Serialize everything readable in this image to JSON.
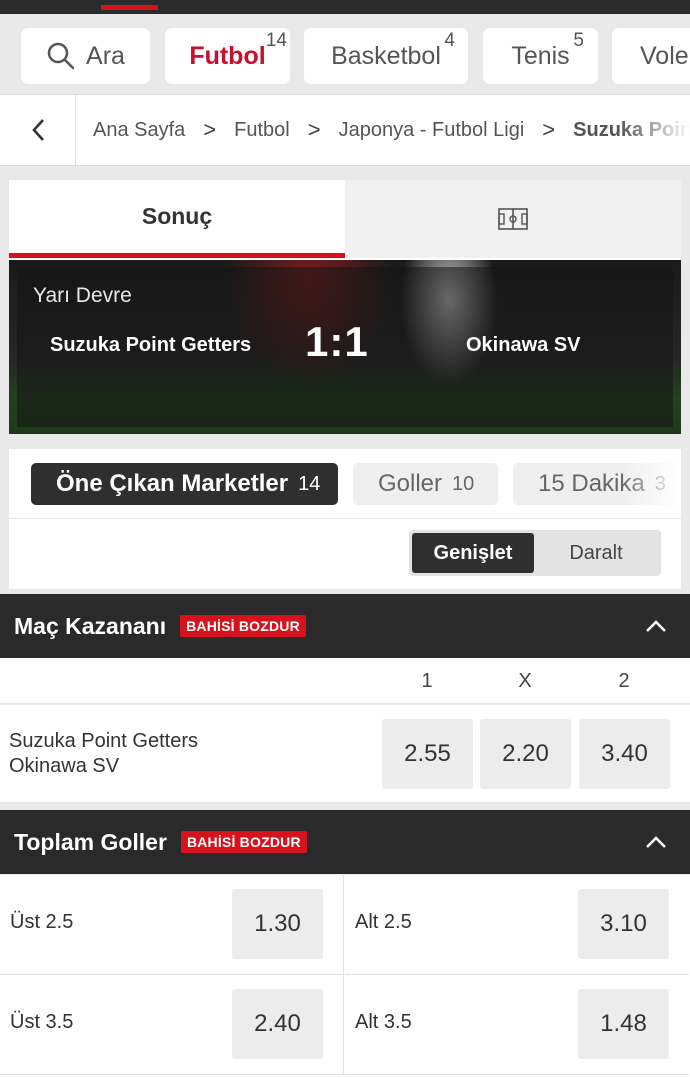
{
  "sports_tabs": [
    {
      "label": "Ara",
      "count": ""
    },
    {
      "label": "Futbol",
      "count": "14"
    },
    {
      "label": "Basketbol",
      "count": "4"
    },
    {
      "label": "Tenis",
      "count": "5"
    },
    {
      "label": "Vole",
      "count": ""
    }
  ],
  "breadcrumb": {
    "items": [
      "Ana Sayfa",
      "Futbol",
      "Japonya - Futbol Ligi"
    ],
    "current": "Suzuka Poin",
    "separator": ">"
  },
  "scorecard": {
    "tab_result": "Sonuç",
    "status": "Yarı Devre",
    "home": "Suzuka Point Getters",
    "score": "1:1",
    "away": "Okinawa SV"
  },
  "market_tabs": [
    {
      "label": "Öne Çıkan Marketler",
      "count": "14"
    },
    {
      "label": "Goller",
      "count": "10"
    },
    {
      "label": "15 Dakika",
      "count": "3"
    }
  ],
  "view_toggle": {
    "expand": "Genişlet",
    "collapse": "Daralt"
  },
  "match_winner": {
    "title": "Maç Kazananı",
    "badge": "BAHİSİ BOZDUR",
    "col_labels": [
      "1",
      "X",
      "2"
    ],
    "team1": "Suzuka Point Getters",
    "team2": "Okinawa SV",
    "odds": [
      "2.55",
      "2.20",
      "3.40"
    ]
  },
  "total_goals": {
    "title": "Toplam Goller",
    "badge": "BAHİSİ BOZDUR",
    "rows": [
      {
        "over_label": "Üst 2.5",
        "over_odd": "1.30",
        "under_label": "Alt 2.5",
        "under_odd": "3.10"
      },
      {
        "over_label": "Üst 3.5",
        "over_odd": "2.40",
        "under_label": "Alt 3.5",
        "under_odd": "1.48"
      }
    ]
  },
  "colors": {
    "accent": "#d8121c",
    "dark": "#2a2a2a",
    "odds_bg": "#ececec"
  }
}
